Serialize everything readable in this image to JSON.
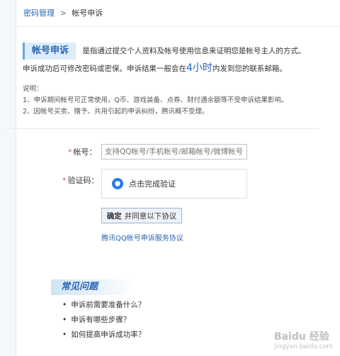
{
  "breadcrumb": {
    "parent": "密码管理",
    "separator": ">",
    "current": "帐号申诉"
  },
  "intro": {
    "badge": "帐号申诉",
    "line1": "是指通过提交个人资料及帐号使用信息来证明您是帐号主人的方式。",
    "line2_prefix": "申诉成功后可修改密码或密保。申诉结果一般会在",
    "line2_highlight": "4小时",
    "line2_suffix": "内发到您的联系邮箱。"
  },
  "notes": {
    "title": "说明：",
    "items": [
      "1、申诉期间帐号可正常使用，Q币、游戏装备、点券、财付通余额等不受申诉结果影响。",
      "2、因帐号买卖、赠予、共用引起的申诉纠纷，腾讯概不受理。"
    ]
  },
  "form": {
    "required_mark": "*",
    "account_label": "帐号：",
    "account_placeholder": "支持QQ帐号/手机帐号/邮箱帐号/微博帐号",
    "verify_label": "验证码：",
    "verify_text": "点击完成验证",
    "confirm_bold": "确定",
    "confirm_rest": "并同意以下协议",
    "agreement_link": "腾讯QQ帐号申诉服务协议"
  },
  "faq": {
    "title": "常见问题",
    "items": [
      "申诉前需要准备什么？",
      "申诉有哪些步骤？",
      "如何提高申诉成功率？"
    ]
  },
  "watermark": {
    "main": "Baidu 经验",
    "sub": "jingyan.baidu.com"
  },
  "colors": {
    "link": "#2a65b8",
    "required": "#d9534f",
    "verify_icon": "#2a7be4"
  }
}
